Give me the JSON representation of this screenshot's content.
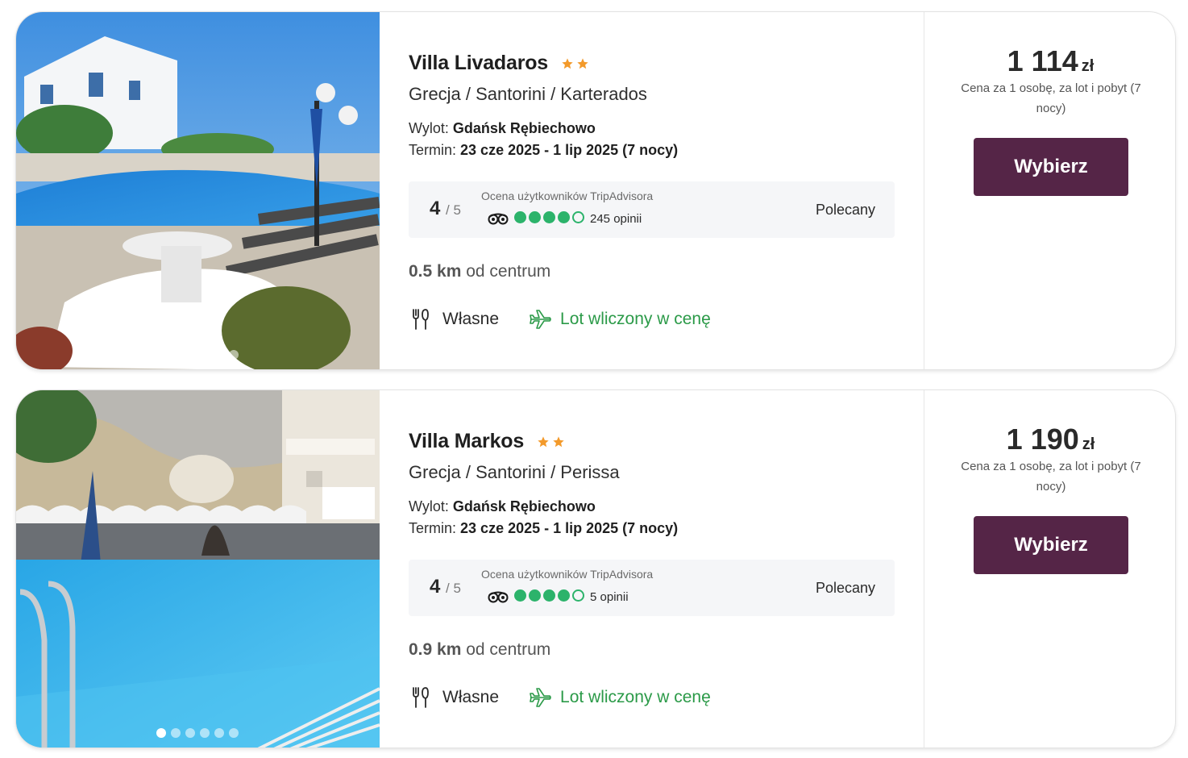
{
  "offers": [
    {
      "hotel_name": "Villa Livadaros",
      "stars": 2,
      "location": "Grecja / Santorini / Karterados",
      "departure_label": "Wylot:",
      "departure_value": "Gdańsk Rębiechowo",
      "term_label": "Termin:",
      "term_value": "23 cze 2025 - 1 lip 2025 (7 nocy)",
      "rating_score": "4",
      "rating_max": "/ 5",
      "rating_label": "Ocena użytkowników TripAdvisora",
      "rating_bubbles": 4,
      "reviews": "245 opinii",
      "recommended": "Polecany",
      "distance_value": "0.5 km",
      "distance_suffix": "od centrum",
      "board": "Własne",
      "flight_included": "Lot wliczony w cenę",
      "price": "1 114",
      "currency": "zł",
      "price_note": "Cena za 1 osobę, za lot i pobyt (7 nocy)",
      "button_label": "Wybierz",
      "gallery_active_index": 0
    },
    {
      "hotel_name": "Villa Markos",
      "stars": 2,
      "location": "Grecja / Santorini / Perissa",
      "departure_label": "Wylot:",
      "departure_value": "Gdańsk Rębiechowo",
      "term_label": "Termin:",
      "term_value": "23 cze 2025 - 1 lip 2025 (7 nocy)",
      "rating_score": "4",
      "rating_max": "/ 5",
      "rating_label": "Ocena użytkowników TripAdvisora",
      "rating_bubbles": 4,
      "reviews": "5 opinii",
      "recommended": "Polecany",
      "distance_value": "0.9 km",
      "distance_suffix": "od centrum",
      "board": "Własne",
      "flight_included": "Lot wliczony w cenę",
      "price": "1 190",
      "currency": "zł",
      "price_note": "Cena za 1 osobę, za lot i pobyt (7 nocy)",
      "button_label": "Wybierz",
      "gallery_active_index": 0
    }
  ],
  "icons": {
    "star": "star-icon",
    "tripadvisor": "tripadvisor-owl-icon",
    "board": "fork-knife-icon",
    "flight": "airplane-icon"
  },
  "colors": {
    "button": "#552547",
    "star": "#f39a2b",
    "tripadvisor_green": "#2cb36b",
    "flight_green": "#2b9a48"
  }
}
